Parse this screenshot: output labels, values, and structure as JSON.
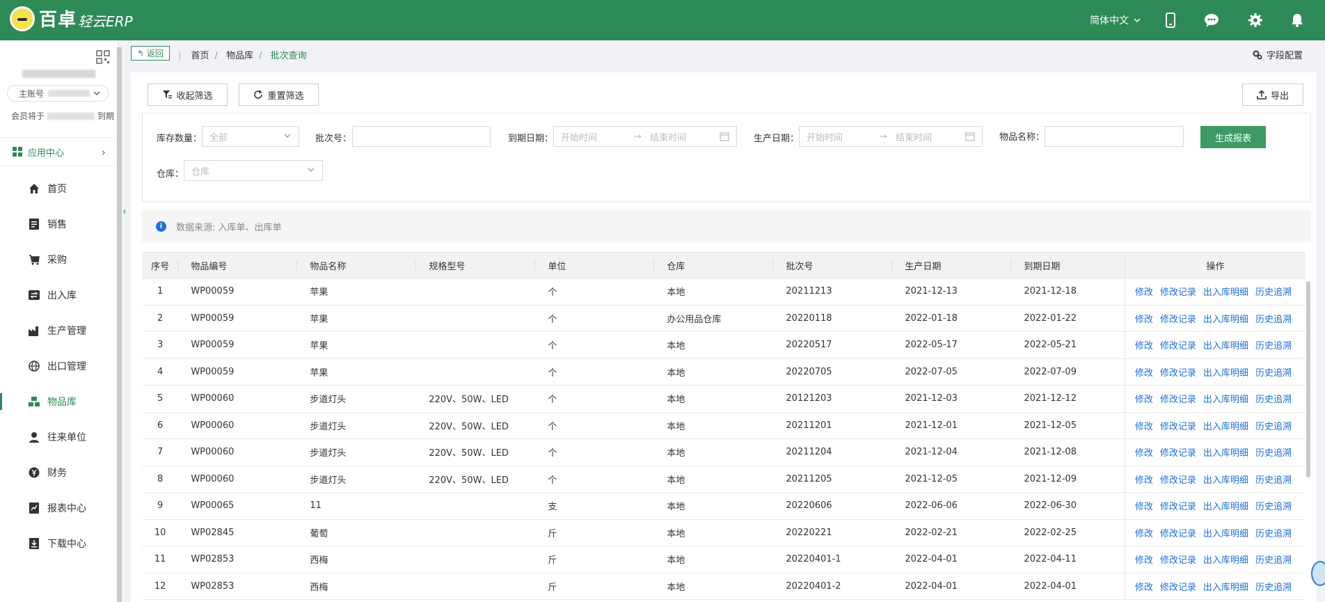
{
  "header": {
    "logo_text": "百卓",
    "logo_sub": "轻云ERP",
    "language": "简体中文"
  },
  "sidebar": {
    "account_label": "主账号",
    "member_prefix": "会员将于",
    "member_suffix": "到期",
    "app_center": "应用中心",
    "items": [
      {
        "label": "首页",
        "icon": "home-icon"
      },
      {
        "label": "销售",
        "icon": "document-icon"
      },
      {
        "label": "采购",
        "icon": "cart-icon"
      },
      {
        "label": "出入库",
        "icon": "transfer-icon"
      },
      {
        "label": "生产管理",
        "icon": "factory-icon"
      },
      {
        "label": "出口管理",
        "icon": "globe-icon"
      },
      {
        "label": "物品库",
        "icon": "boxes-icon",
        "active": true
      },
      {
        "label": "往来单位",
        "icon": "user-icon"
      },
      {
        "label": "财务",
        "icon": "yen-icon"
      },
      {
        "label": "报表中心",
        "icon": "report-icon"
      },
      {
        "label": "下载中心",
        "icon": "download-icon"
      }
    ]
  },
  "breadcrumb": {
    "back": "返回",
    "items": [
      "首页",
      "物品库",
      "批次查询"
    ]
  },
  "toolbar": {
    "field_config": "字段配置",
    "collapse_filter": "收起筛选",
    "reset_filter": "重置筛选",
    "export": "导出"
  },
  "filters": {
    "stock_qty_label": "库存数量：",
    "stock_qty_value": "全部",
    "batch_label": "批次号：",
    "batch_value": "",
    "expire_label": "到期日期：",
    "start_placeholder": "开始时间",
    "end_placeholder": "结束时间",
    "produce_label": "生产日期：",
    "item_name_label": "物品名称：",
    "item_name_value": "",
    "warehouse_label": "仓库：",
    "warehouse_placeholder": "仓库",
    "generate": "生成报表"
  },
  "info": "数据来源: 入库单、出库单",
  "table": {
    "headers": [
      "序号",
      "物品编号",
      "物品名称",
      "规格型号",
      "单位",
      "仓库",
      "批次号",
      "生产日期",
      "到期日期",
      "操作"
    ],
    "ops": [
      "修改",
      "修改记录",
      "出入库明细",
      "历史追溯"
    ],
    "rows": [
      [
        "1",
        "WP00059",
        "苹果",
        "",
        "个",
        "本地",
        "20211213",
        "2021-12-13",
        "2021-12-18"
      ],
      [
        "2",
        "WP00059",
        "苹果",
        "",
        "个",
        "办公用品仓库",
        "20220118",
        "2022-01-18",
        "2022-01-22"
      ],
      [
        "3",
        "WP00059",
        "苹果",
        "",
        "个",
        "本地",
        "20220517",
        "2022-05-17",
        "2022-05-21"
      ],
      [
        "4",
        "WP00059",
        "苹果",
        "",
        "个",
        "本地",
        "20220705",
        "2022-07-05",
        "2022-07-09"
      ],
      [
        "5",
        "WP00060",
        "步道灯头",
        "220V、50W、LED",
        "个",
        "本地",
        "20121203",
        "2021-12-03",
        "2021-12-12"
      ],
      [
        "6",
        "WP00060",
        "步道灯头",
        "220V、50W、LED",
        "个",
        "本地",
        "20211201",
        "2021-12-01",
        "2021-12-05"
      ],
      [
        "7",
        "WP00060",
        "步道灯头",
        "220V、50W、LED",
        "个",
        "本地",
        "20211204",
        "2021-12-04",
        "2021-12-08"
      ],
      [
        "8",
        "WP00060",
        "步道灯头",
        "220V、50W、LED",
        "个",
        "本地",
        "20211205",
        "2021-12-05",
        "2021-12-09"
      ],
      [
        "9",
        "WP00065",
        "11",
        "",
        "支",
        "本地",
        "20220606",
        "2022-06-06",
        "2022-06-30"
      ],
      [
        "10",
        "WP02845",
        "葡萄",
        "",
        "斤",
        "本地",
        "20220221",
        "2022-02-21",
        "2022-02-25"
      ],
      [
        "11",
        "WP02853",
        "西梅",
        "",
        "斤",
        "本地",
        "20220401-1",
        "2022-04-01",
        "2022-04-11"
      ],
      [
        "12",
        "WP02853",
        "西梅",
        "",
        "斤",
        "本地",
        "20220401-2",
        "2022-04-01",
        "2022-04-01"
      ]
    ]
  },
  "colors": {
    "brand": "#2d8a57",
    "link": "#1e6fd9",
    "generate_button": "#3d9a64"
  }
}
